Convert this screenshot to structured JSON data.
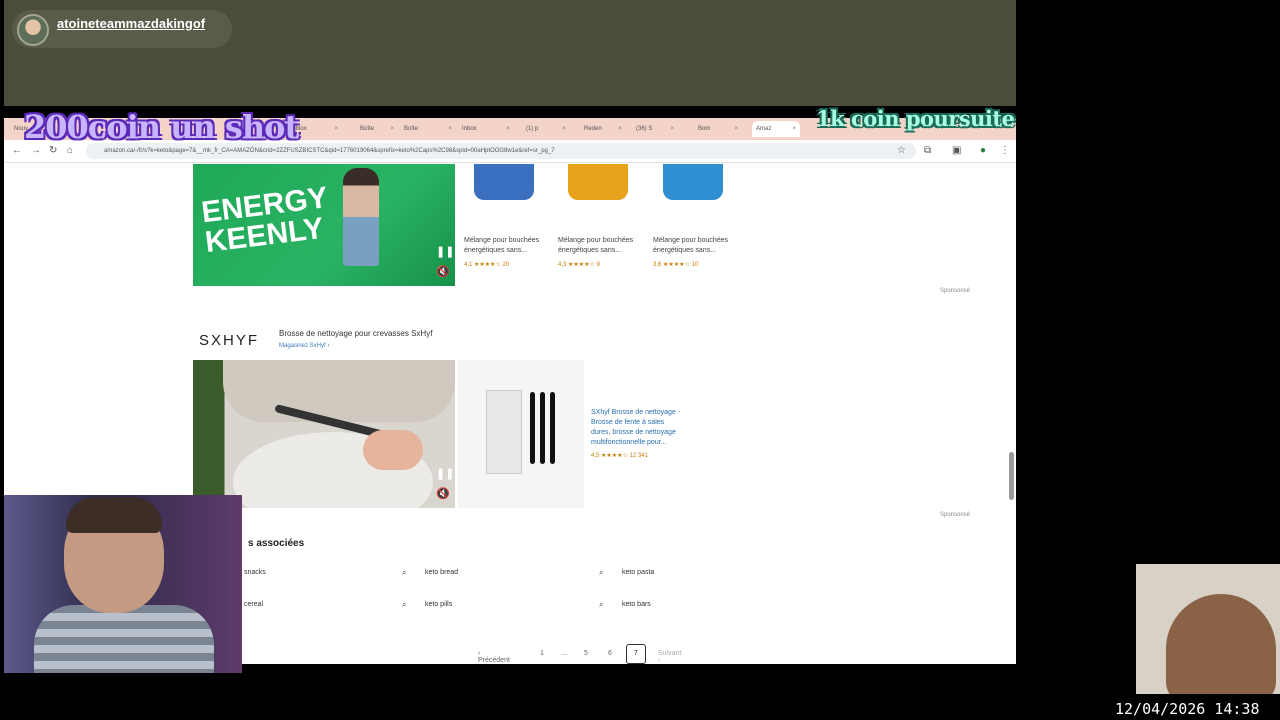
{
  "stream": {
    "username": "atoineteammazdakingof",
    "overlay_left": "200coin un shot",
    "overlay_right": "1k coin poursuite",
    "clock": "12/04/2026 14:38"
  },
  "browser": {
    "url": "amazon.ca/-/fr/s?k=keto&page=7&__mk_fr_CA=AMAZÔN&crid=2ZZFUSZBICSTC&qid=1776019064&sprefix=keto%2Caps%2C98&xpid=00aHptOOG8w1e&ref=sr_pg_7",
    "tabs": [
      "Nouv",
      "",
      "",
      "Roblox",
      "Boîte",
      "Boîte",
      "Inbox",
      "(1) p",
      "Reden",
      "(36) S",
      "Bom",
      "Amaz"
    ]
  },
  "products": [
    {
      "title": "Mélange pour bouchées énergétiques sans...",
      "rating": "4,1 ★★★★☆ 20",
      "color": "#3a6fc0"
    },
    {
      "title": "Mélange pour bouchées énergétiques sans...",
      "rating": "4,3 ★★★★☆ 9",
      "color": "#e8a21c"
    },
    {
      "title": "Mélange pour bouchées énergétiques sans...",
      "rating": "3,6 ★★★★☆ 10",
      "color": "#2f8fd0"
    }
  ],
  "sponsor": {
    "brand": "SXHYF",
    "headline": "Brosse de nettoyage pour crevasses SxHyf",
    "store_link": "Magasinez SxHyf ›",
    "product_title": "SXhyf Brosse de nettoyage - Brosse de fente à sales dures, brosse de nettoyage multifonctionnelle pour...",
    "product_rating": "4,5 ★★★★☆ 12 341",
    "sponsored": "Sponsorisé"
  },
  "banner": {
    "text": "ENERGY KEENLY"
  },
  "related": {
    "heading": "s associées",
    "items": [
      "snacks",
      "keto bread",
      "keto pasta",
      "cereal",
      "keto pills",
      "keto bars"
    ]
  },
  "pagination": {
    "prev": "Précédent",
    "pages": [
      "1",
      "...",
      "5",
      "6"
    ],
    "current": "7",
    "next": "Suivant"
  }
}
